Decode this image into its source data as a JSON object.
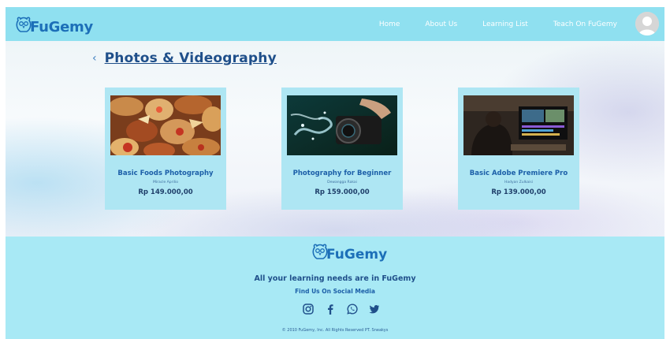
{
  "brand": {
    "name": "FuGemy"
  },
  "nav": {
    "links": [
      "Home",
      "About Us",
      "Learning List",
      "Teach On FuGemy"
    ]
  },
  "page": {
    "back_icon": "chevron-left-icon",
    "title": "Photos & Videography"
  },
  "courses": [
    {
      "title": "Basic Foods Photography",
      "author": "Miracle Aprilio",
      "price": "Rp 149.000,00",
      "image": "food-photo"
    },
    {
      "title": "Photography for Beginner",
      "author": "Dewangga Rakai",
      "price": "Rp 159.000,00",
      "image": "camera-splash-photo"
    },
    {
      "title": "Basic Adobe Premiere Pro",
      "author": "Hadyan Zulkaisi",
      "price": "Rp 139.000,00",
      "image": "video-editing-photo"
    }
  ],
  "footer": {
    "brand": "FuGemy",
    "tagline": "All your learning needs are in FuGemy",
    "find_us": "Find Us On Social Media",
    "social": [
      "instagram-icon",
      "facebook-icon",
      "whatsapp-icon",
      "twitter-icon"
    ],
    "copyright": "© 2010 FuGemy, Inc. All Rights Reserved PT. Sneakys"
  },
  "colors": {
    "nav_bg": "#8fe0f0",
    "footer_bg": "#a8e9f5",
    "card_bg": "#aee6f3",
    "accent": "#1c5fa8"
  }
}
